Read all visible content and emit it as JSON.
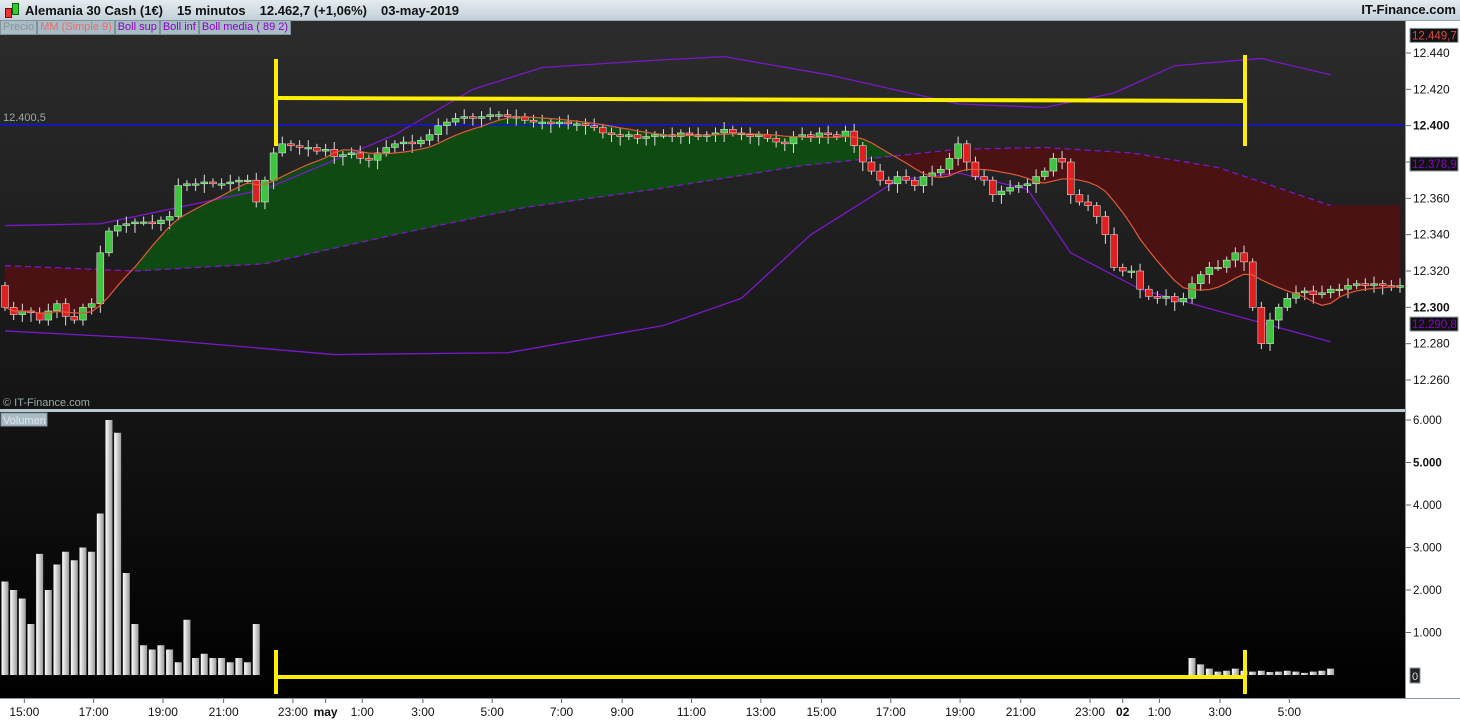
{
  "header": {
    "instrument": "Alemania 30 Cash (1€)",
    "timeframe": "15 minutos",
    "last_price": "12.462,7 (+1,06%)",
    "date": "03-may-2019",
    "brand": "IT-Finance.com"
  },
  "legend": [
    {
      "label": "Precio",
      "color": "#8a9499"
    },
    {
      "label": "MM (Simple 9)",
      "color": "#e86a6a"
    },
    {
      "label": "Boll sup",
      "color": "#8a00c8"
    },
    {
      "label": "Boll inf",
      "color": "#8a00c8"
    },
    {
      "label": "Boll media ( 89 2)",
      "color": "#8a00c8"
    }
  ],
  "watermark": "© IT-Finance.com",
  "volume_label": "Volumen",
  "colors": {
    "up": "#3fc43f",
    "down": "#e02020",
    "ma": "#e05a3a",
    "boll": "#7a18c8",
    "ref_line": "#1010ff",
    "annotation": "#ffee00",
    "fill_up": "#0f4a12",
    "fill_down": "#4a1212"
  },
  "chart_data": [
    {
      "type": "candlestick",
      "title": "Alemania 30 Cash (1€) 15 minutos",
      "ylim": [
        12250,
        12458
      ],
      "price_ticks": [
        {
          "v": 12440,
          "label": "12.440",
          "bold": false
        },
        {
          "v": 12420,
          "label": "12.420",
          "bold": false
        },
        {
          "v": 12400,
          "label": "12.400",
          "bold": true
        },
        {
          "v": 12380,
          "label": "12.380",
          "bold": false
        },
        {
          "v": 12360,
          "label": "12.360",
          "bold": false
        },
        {
          "v": 12340,
          "label": "12.340",
          "bold": false
        },
        {
          "v": 12320,
          "label": "12.320",
          "bold": false
        },
        {
          "v": 12300,
          "label": "12.300",
          "bold": true
        },
        {
          "v": 12280,
          "label": "12.280",
          "bold": false
        },
        {
          "v": 12260,
          "label": "12.260",
          "bold": false
        }
      ],
      "price_markers": [
        {
          "v": 12449.7,
          "label": "12.449,7",
          "color": "#e04848"
        },
        {
          "v": 12378.9,
          "label": "12.378,9",
          "color": "#8a00c8"
        },
        {
          "v": 12290.8,
          "label": "12.290,8",
          "color": "#8a00c8"
        }
      ],
      "reference_line": {
        "v": 12400.5,
        "label": "12.400,5"
      },
      "first_open": 12312,
      "closes": [
        12300,
        12296,
        12298,
        12297,
        12293,
        12298,
        12302,
        12295,
        12293,
        12300,
        12302,
        12330,
        12342,
        12345,
        12346,
        12347,
        12347,
        12346,
        12348,
        12350,
        12367,
        12368,
        12368,
        12369,
        12368,
        12368,
        12369,
        12370,
        12370,
        12358,
        12370,
        12385,
        12390,
        12389,
        12388,
        12388,
        12386,
        12387,
        12383,
        12384,
        12385,
        12382,
        12381,
        12385,
        12388,
        12390,
        12391,
        12390,
        12392,
        12395,
        12400,
        12402,
        12404,
        12405,
        12404,
        12405,
        12406,
        12406,
        12405,
        12405,
        12403,
        12402,
        12402,
        12401,
        12402,
        12401,
        12401,
        12400,
        12399,
        12396,
        12395,
        12394,
        12395,
        12393,
        12394,
        12395,
        12395,
        12394,
        12396,
        12395,
        12394,
        12395,
        12396,
        12398,
        12396,
        12395,
        12394,
        12395,
        12393,
        12391,
        12390,
        12394,
        12395,
        12394,
        12396,
        12395,
        12394,
        12397,
        12389,
        12380,
        12375,
        12370,
        12368,
        12372,
        12370,
        12367,
        12372,
        12374,
        12376,
        12382,
        12390,
        12380,
        12372,
        12370,
        12362,
        12364,
        12366,
        12367,
        12368,
        12372,
        12375,
        12382,
        12380,
        12362,
        12358,
        12356,
        12350,
        12340,
        12322,
        12320,
        12320,
        12310,
        12306,
        12305,
        12306,
        12303,
        12305,
        12313,
        12318,
        12322,
        12322,
        12326,
        12330,
        12325,
        12300,
        12280,
        12293,
        12300,
        12305,
        12308,
        12309,
        12307,
        12308,
        12310,
        12310,
        12312,
        12313,
        12312,
        12313,
        12312,
        12311,
        12312
      ],
      "ma_period": 9,
      "boll_sup": [
        [
          0,
          12345
        ],
        [
          11,
          12346
        ],
        [
          30,
          12365
        ],
        [
          45,
          12395
        ],
        [
          54,
          12420
        ],
        [
          62,
          12432
        ],
        [
          75,
          12436
        ],
        [
          83,
          12438
        ],
        [
          95,
          12428
        ],
        [
          110,
          12412
        ],
        [
          120,
          12410
        ],
        [
          128,
          12418
        ],
        [
          135,
          12433
        ],
        [
          145,
          12437
        ],
        [
          153,
          12428
        ]
      ],
      "boll_media": [
        [
          0,
          12323
        ],
        [
          15,
          12320
        ],
        [
          30,
          12324
        ],
        [
          45,
          12340
        ],
        [
          60,
          12355
        ],
        [
          75,
          12365
        ],
        [
          92,
          12378
        ],
        [
          110,
          12387
        ],
        [
          120,
          12388
        ],
        [
          130,
          12385
        ],
        [
          140,
          12377
        ],
        [
          153,
          12356
        ]
      ],
      "boll_inf": [
        [
          0,
          12287
        ],
        [
          16,
          12283
        ],
        [
          38,
          12274
        ],
        [
          58,
          12275
        ],
        [
          76,
          12290
        ],
        [
          85,
          12305
        ],
        [
          93,
          12340
        ],
        [
          103,
          12370
        ],
        [
          110,
          12374
        ],
        [
          118,
          12365
        ],
        [
          123,
          12330
        ],
        [
          131,
          12310
        ],
        [
          140,
          12298
        ],
        [
          153,
          12281
        ]
      ],
      "x_ticks": [
        {
          "i": 2,
          "label": "15:00"
        },
        {
          "i": 10,
          "label": "17:00"
        },
        {
          "i": 18,
          "label": "19:00"
        },
        {
          "i": 25,
          "label": "21:00"
        },
        {
          "i": 33,
          "label": "23:00"
        },
        {
          "i": 37,
          "label": "may",
          "bold": true
        },
        {
          "i": 41,
          "label": "1:00"
        },
        {
          "i": 48,
          "label": "3:00"
        },
        {
          "i": 56,
          "label": "5:00"
        },
        {
          "i": 64,
          "label": "7:00"
        },
        {
          "i": 71,
          "label": "9:00"
        },
        {
          "i": 79,
          "label": "11:00"
        },
        {
          "i": 87,
          "label": "13:00"
        },
        {
          "i": 94,
          "label": "15:00"
        },
        {
          "i": 102,
          "label": "17:00"
        },
        {
          "i": 110,
          "label": "19:00"
        },
        {
          "i": 117,
          "label": "21:00"
        },
        {
          "i": 125,
          "label": "23:00"
        },
        {
          "i": 129,
          "label": "02",
          "bold": true
        },
        {
          "i": 133,
          "label": "1:00"
        },
        {
          "i": 140,
          "label": "3:00"
        },
        {
          "i": 148,
          "label": "5:00"
        }
      ]
    },
    {
      "type": "bar",
      "title": "Volumen",
      "ylim": [
        0,
        6300
      ],
      "ticks": [
        {
          "v": 6000,
          "label": "6.000",
          "bold": false
        },
        {
          "v": 5000,
          "label": "5.000",
          "bold": true
        },
        {
          "v": 4000,
          "label": "4.000",
          "bold": false
        },
        {
          "v": 3000,
          "label": "3.000",
          "bold": false
        },
        {
          "v": 2000,
          "label": "2.000",
          "bold": false
        },
        {
          "v": 1000,
          "label": "1.000",
          "bold": false
        }
      ],
      "zero_label": "0",
      "segments": [
        {
          "start": 0,
          "values": [
            2200,
            2000,
            1800,
            1200,
            2850,
            2000,
            2600,
            2900,
            2700,
            3000,
            2900,
            3800,
            6000,
            5700,
            2400,
            1200,
            700,
            600,
            700,
            600,
            300,
            1300,
            400,
            500,
            400,
            400,
            300,
            400,
            300,
            1200
          ]
        },
        {
          "start": 137,
          "values": [
            400,
            250,
            150,
            80,
            100,
            150,
            100,
            80,
            100,
            70,
            80,
            100,
            80,
            50,
            80,
            100,
            150
          ]
        }
      ]
    }
  ]
}
